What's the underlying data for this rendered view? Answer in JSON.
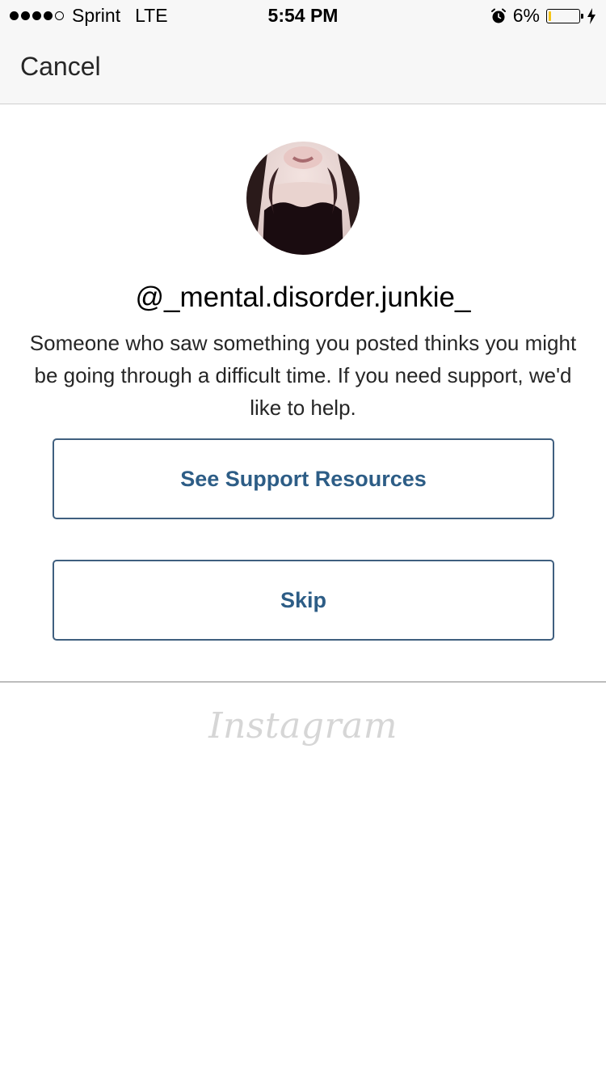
{
  "status_bar": {
    "signal_bars_filled": 4,
    "signal_bars_total": 5,
    "carrier": "Sprint",
    "network": "LTE",
    "time": "5:54 PM",
    "battery_percent": "6%",
    "battery_level": 0.06,
    "battery_color": "#f5c518",
    "icons": [
      "alarm-icon",
      "battery-icon",
      "charging-bolt-icon"
    ]
  },
  "nav": {
    "cancel_label": "Cancel"
  },
  "profile": {
    "username": "@_mental.disorder.junkie_",
    "message": "Someone who saw something you posted thinks you might be going through a difficult time. If you need support, we'd like to help."
  },
  "actions": {
    "support_label": "See Support Resources",
    "skip_label": "Skip",
    "accent_color": "#2d5d86"
  },
  "footer": {
    "logo_text": "Instagram"
  }
}
